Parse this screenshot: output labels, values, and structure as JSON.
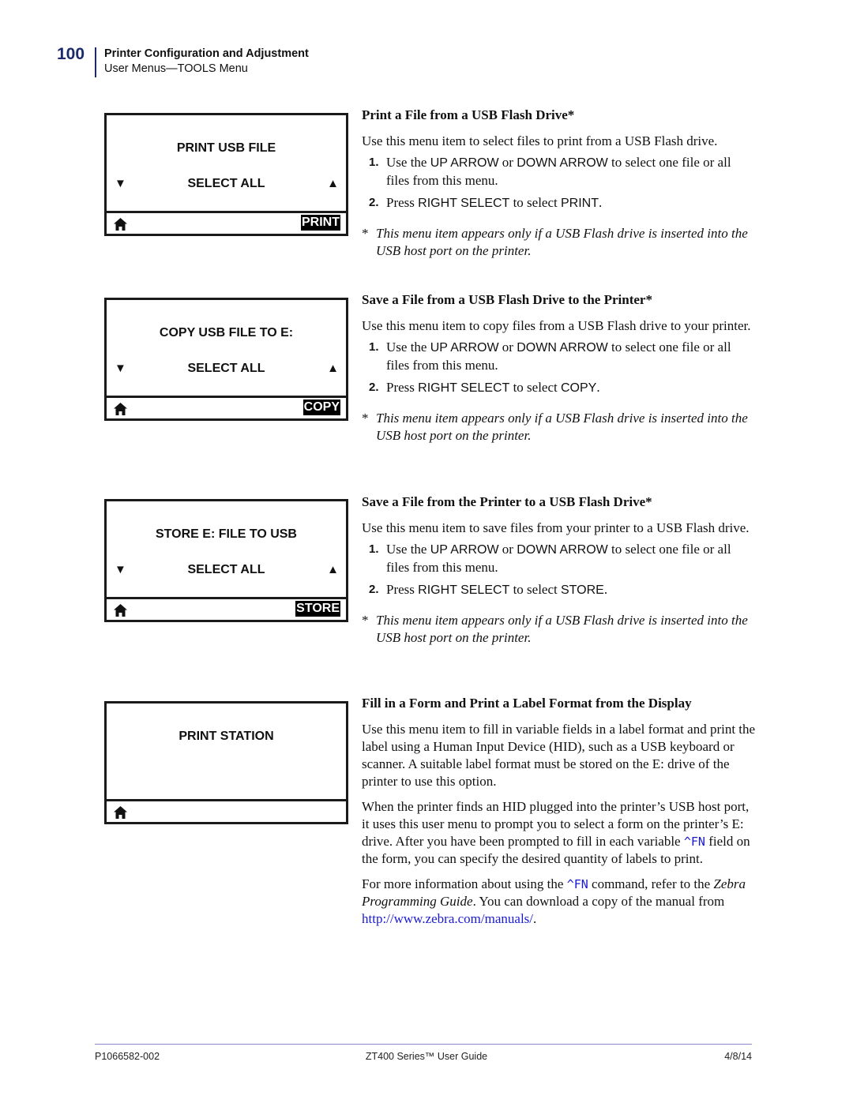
{
  "header": {
    "page_number": "100",
    "chapter_title": "Printer Configuration and Adjustment",
    "section_subtitle": "User Menus—TOOLS Menu",
    "accent_color": "#1b2a6b"
  },
  "panels": [
    {
      "title": "PRINT USB FILE",
      "row": "SELECT ALL",
      "down_arrow": "▼",
      "up_arrow": "▲",
      "softkey": "PRINT",
      "left_icon": "home-icon"
    },
    {
      "title": "COPY USB FILE TO E:",
      "row": "SELECT ALL",
      "down_arrow": "▼",
      "up_arrow": "▲",
      "softkey": "COPY",
      "left_icon": "home-icon"
    },
    {
      "title": "STORE E: FILE TO USB",
      "row": "SELECT ALL",
      "down_arrow": "▼",
      "up_arrow": "▲",
      "softkey": "STORE",
      "left_icon": "home-icon"
    },
    {
      "title": "PRINT STATION",
      "left_icon": "home-icon"
    }
  ],
  "sections": [
    {
      "heading": "Print a File from a USB Flash Drive*",
      "intro": "Use this menu item to select files to print from a USB Flash drive.",
      "steps": [
        {
          "num": "1.",
          "pre": "Use the ",
          "ui1": "UP ARROW",
          "mid": " or ",
          "ui2": "DOWN ARROW",
          "post": " to select one file or all files from this menu."
        },
        {
          "num": "2.",
          "pre": "Press ",
          "ui1": "RIGHT SELECT",
          "mid": " to select ",
          "ui2": "PRINT",
          "post": "."
        }
      ],
      "note_star": "*",
      "note": "This menu item appears only if a USB Flash drive is inserted into the USB host port on the printer."
    },
    {
      "heading": "Save a File from a USB Flash Drive to the Printer*",
      "intro": "Use this menu item to copy files from a USB Flash drive to your printer.",
      "steps": [
        {
          "num": "1.",
          "pre": "Use the ",
          "ui1": "UP ARROW",
          "mid": " or ",
          "ui2": "DOWN ARROW",
          "post": " to select one file or all files from this menu."
        },
        {
          "num": "2.",
          "pre": "Press ",
          "ui1": "RIGHT SELECT",
          "mid": " to select ",
          "ui2": "COPY",
          "post": "."
        }
      ],
      "note_star": "*",
      "note": "This menu item appears only if a USB Flash drive is inserted into the USB host port on the printer."
    },
    {
      "heading": "Save a File from the Printer to a USB Flash Drive*",
      "intro": "Use this menu item to save files from your printer to a USB Flash drive.",
      "steps": [
        {
          "num": "1.",
          "pre": "Use the ",
          "ui1": "UP ARROW",
          "mid": " or ",
          "ui2": "DOWN ARROW",
          "post": " to select one file or all files from this menu."
        },
        {
          "num": "2.",
          "pre": "Press ",
          "ui1": "RIGHT SELECT",
          "mid": " to select ",
          "ui2": "STORE",
          "post": "."
        }
      ],
      "note_star": "*",
      "note": "This menu item appears only if a USB Flash drive is inserted into the USB host port on the printer."
    },
    {
      "heading": "Fill in a Form and Print a Label Format from the Display",
      "para1": "Use this menu item to fill in variable fields in a label format and print the label using a Human Input Device (HID), such as a USB keyboard or scanner. A suitable label format must be stored on the E: drive of the printer to use this option.",
      "para2_a": "When the printer finds an HID plugged into the printer’s USB host port, it uses this user menu to prompt you to select a form on the printer’s E: drive. After you have been prompted to fill in each variable ",
      "para2_code": "^FN",
      "para2_b": " field on the form, you can specify the desired quantity of labels to print.",
      "para3_a": "For more information about using the ",
      "para3_code": "^FN",
      "para3_b": " command, refer to the ",
      "para3_italic": "Zebra Programming Guide",
      "para3_c": ". You can download a copy of the manual from ",
      "para3_link": "http://www.zebra.com/manuals/",
      "para3_d": "."
    }
  ],
  "footer": {
    "doc_number": "P1066582-002",
    "guide_title": "ZT400 Series™ User Guide",
    "date": "4/8/14",
    "rule_color": "#8a8ad0"
  }
}
